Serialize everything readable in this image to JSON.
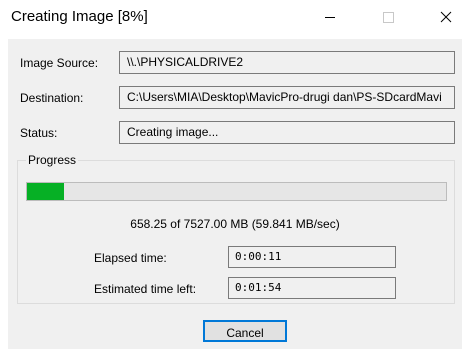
{
  "window": {
    "title": "Creating Image [8%]"
  },
  "titlebar_buttons": {
    "minimize_icon": "minimize-icon",
    "maximize_icon": "maximize-icon",
    "close_icon": "close-icon"
  },
  "form": {
    "source_label": "Image Source:",
    "source_value": "\\\\.\\PHYSICALDRIVE2",
    "destination_label": "Destination:",
    "destination_value": "C:\\Users\\MIA\\Desktop\\MavicPro-drugi dan\\PS-SDcardMavi",
    "status_label": "Status:",
    "status_value": "Creating image..."
  },
  "progress": {
    "group_title": "Progress",
    "fraction": 0.08745,
    "transfer_text": "658.25 of 7527.00 MB (59.841 MB/sec)",
    "elapsed_label": "Elapsed time:",
    "elapsed_value": "0:00:11",
    "remaining_label": "Estimated time left:",
    "remaining_value": "0:01:54",
    "fill_color": "#06b025"
  },
  "actions": {
    "cancel_label": "Cancel"
  }
}
